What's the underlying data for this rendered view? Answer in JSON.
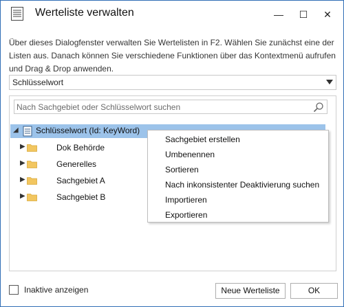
{
  "window": {
    "title": "Werteliste verwalten",
    "controls": {
      "minimize": "—",
      "maximize": "☐",
      "close": "✕"
    }
  },
  "description": "Über dieses Dialogfenster verwalten Sie Wertelisten in F2. Wählen Sie zunächst eine der Listen aus. Danach können Sie verschiedene Funktionen über das Kontextmenü aufrufen und Drag & Drop anwenden.",
  "list_selector": {
    "selected": "Schlüsselwort"
  },
  "search": {
    "placeholder": "Nach Sachgebiet oder Schlüsselwort suchen",
    "value": ""
  },
  "tree": {
    "root": {
      "label": "Schlüsselwort (Id: KeyWord)",
      "expanded": true,
      "selected": true
    },
    "children": [
      {
        "label": "Dok Behörde"
      },
      {
        "label": "Generelles"
      },
      {
        "label": "Sachgebiet A"
      },
      {
        "label": "Sachgebiet B"
      }
    ]
  },
  "context_menu": {
    "items": [
      "Sachgebiet erstellen",
      "Umbenennen",
      "Sortieren",
      "Nach inkonsistenter Deaktivierung suchen",
      "Importieren",
      "Exportieren"
    ]
  },
  "footer": {
    "inactive_checkbox": {
      "label": "Inaktive anzeigen",
      "checked": false
    },
    "new_list_button": "Neue Werteliste",
    "ok_button": "OK"
  },
  "colors": {
    "selection": "#9cc3ea",
    "window_border": "#2f6db5",
    "folder": "#f2c660"
  },
  "icons": {
    "title": "document-list-icon",
    "root": "document-icon",
    "children": "folder-icon",
    "search": "search-icon",
    "combo": "chevron-down-icon"
  }
}
